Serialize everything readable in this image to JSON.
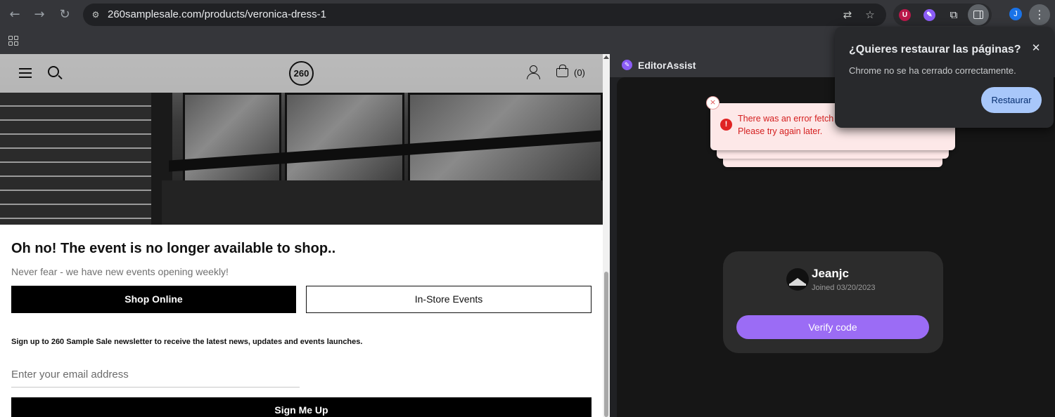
{
  "browser": {
    "url": "260samplesale.com/products/veronica-dress-1",
    "profile_initial": "J",
    "extensions": [
      {
        "name": "ublock",
        "letter": "U",
        "color": "#b9184a"
      },
      {
        "name": "editorassist",
        "letter": "✎",
        "color": "#8b5cf6"
      }
    ]
  },
  "store": {
    "logo_text": "260",
    "cart_count": "(0)",
    "headline": "Oh no! The event is no longer available to shop..",
    "subline": "Never fear - we have new events opening weekly!",
    "shop_online_label": "Shop Online",
    "in_store_label": "In-Store Events",
    "signup_text": "Sign up to 260 Sample Sale newsletter to receive the latest news, updates and events launches.",
    "email_placeholder": "Enter your email address",
    "signup_button_label": "Sign Me Up"
  },
  "side_panel": {
    "title": "EditorAssist",
    "error_line1": "There was an error fetch",
    "error_line2": "Please try again later.",
    "username": "Jeanjc",
    "joined": "Joined 03/20/2023",
    "verify_label": "Verify code"
  },
  "restore_popup": {
    "title": "¿Quieres restaurar las páginas?",
    "message": "Chrome no se ha cerrado correctamente.",
    "button_label": "Restaurar"
  }
}
